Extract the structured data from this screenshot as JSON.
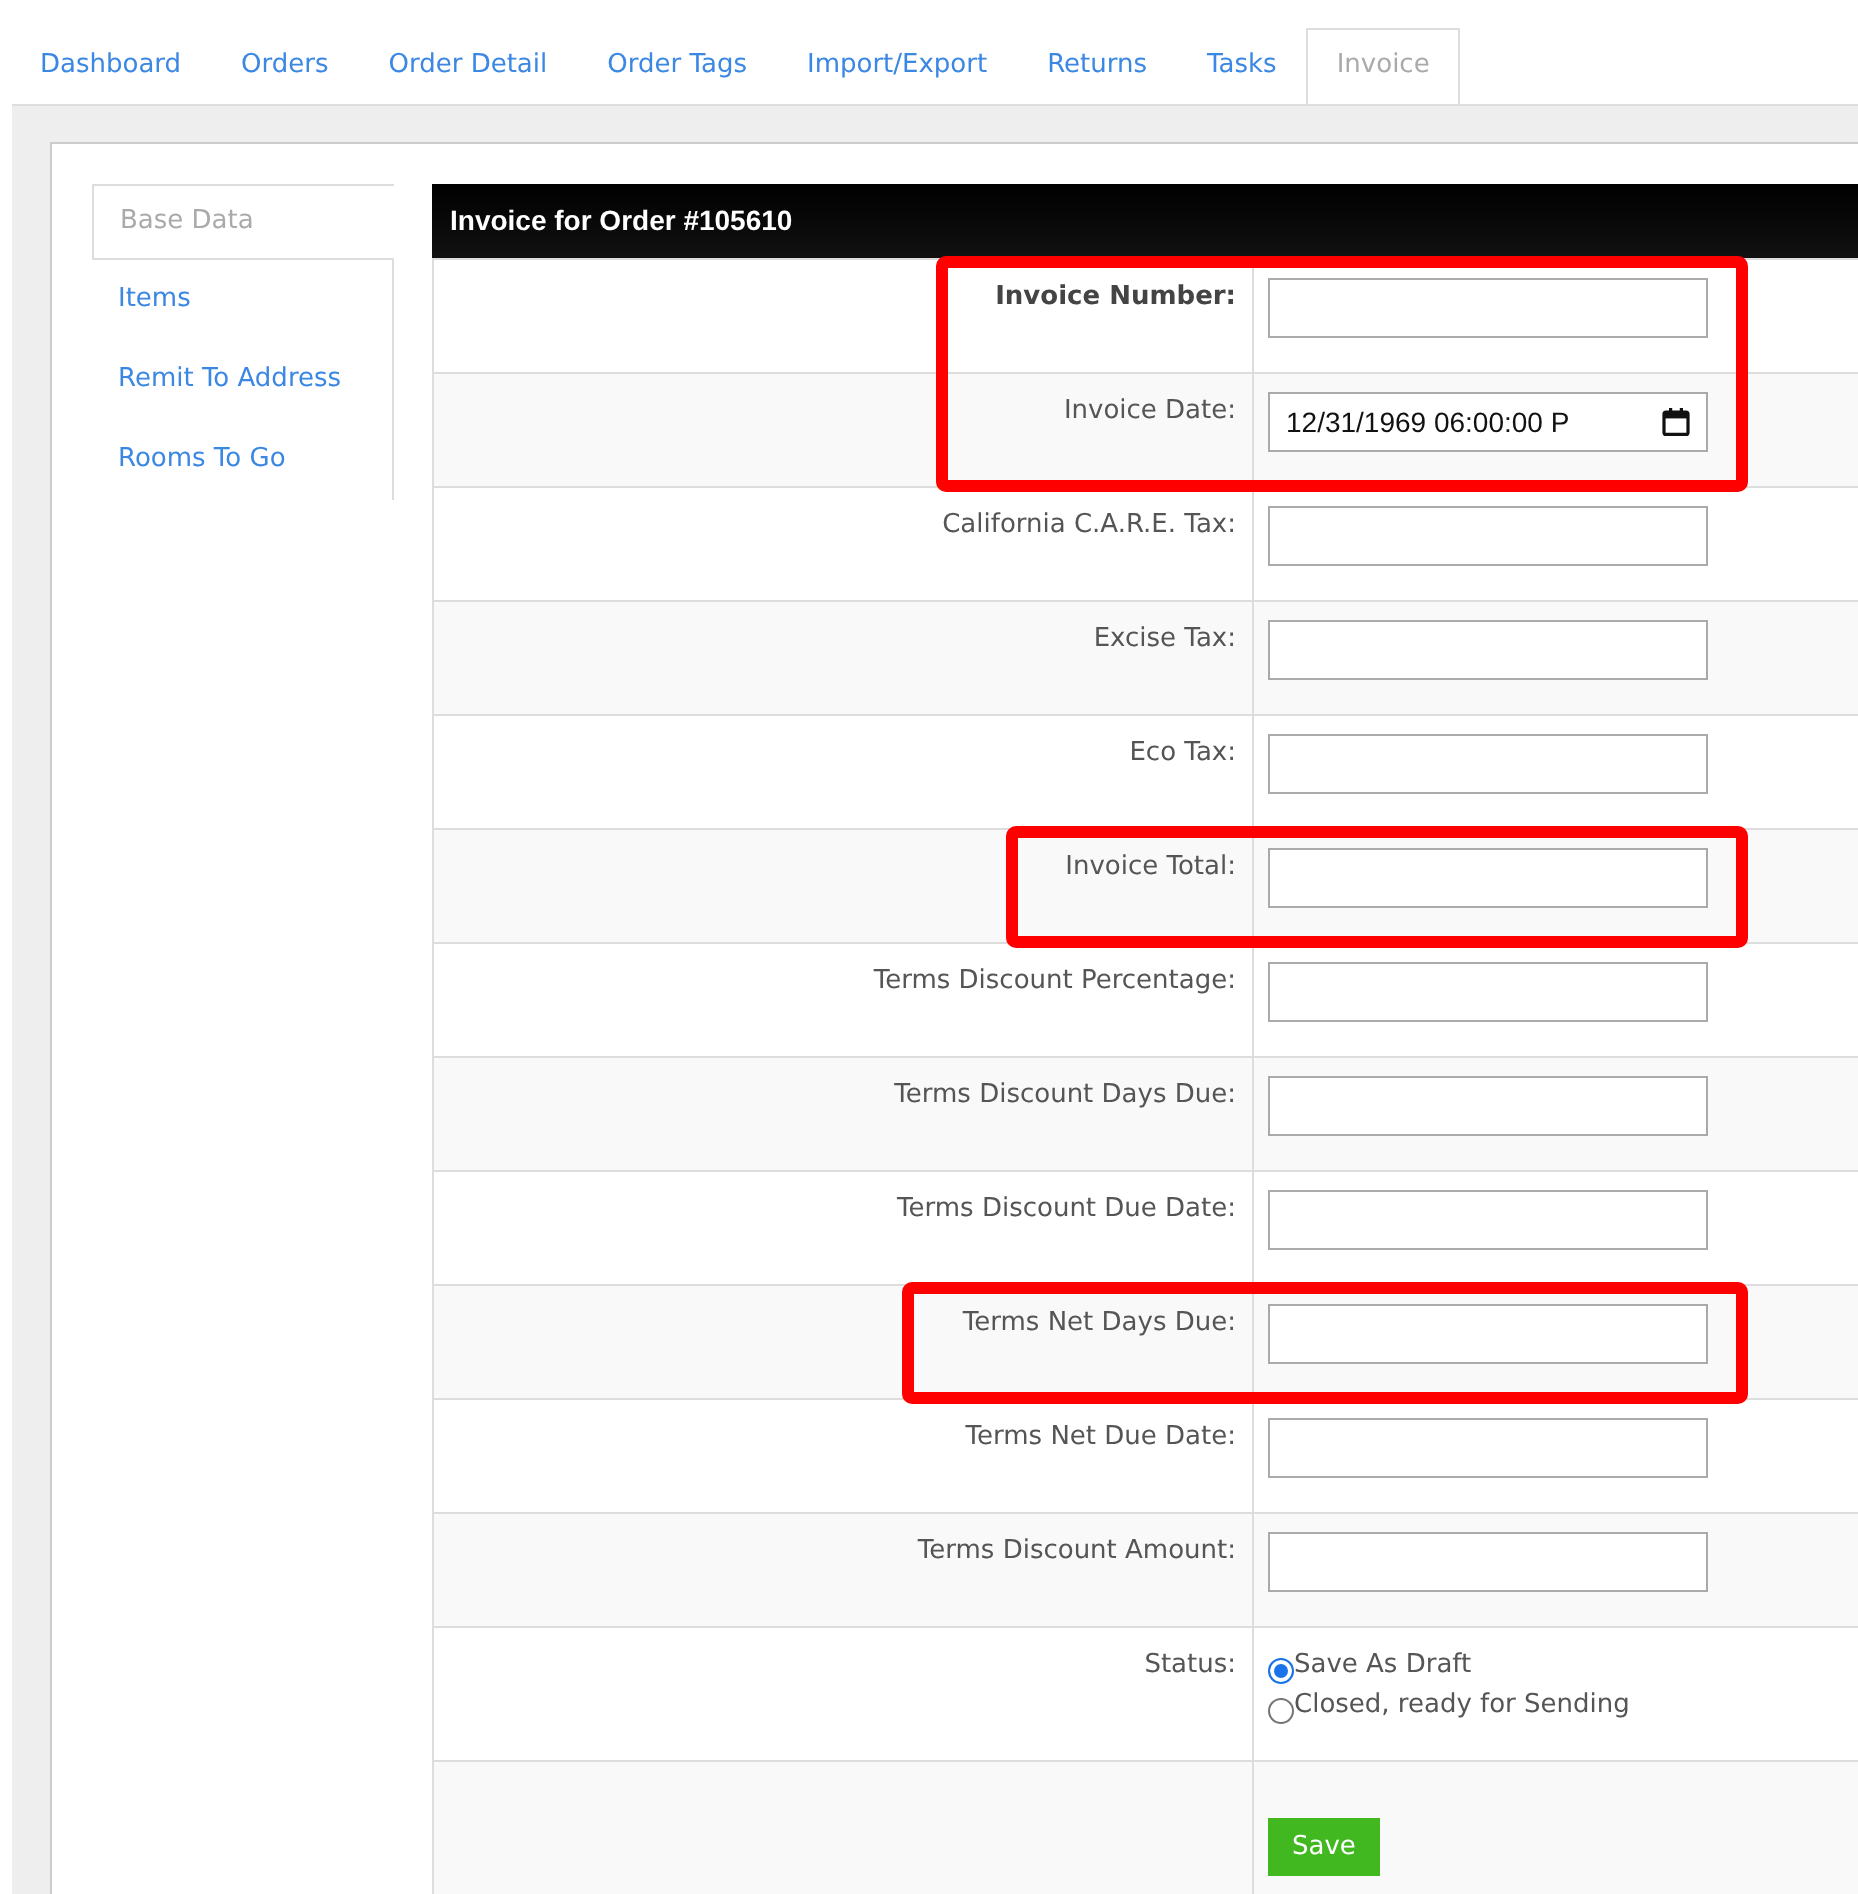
{
  "tabs": [
    {
      "label": "Dashboard",
      "selected": false
    },
    {
      "label": "Orders",
      "selected": false
    },
    {
      "label": "Order Detail",
      "selected": false
    },
    {
      "label": "Order Tags",
      "selected": false
    },
    {
      "label": "Import/Export",
      "selected": false
    },
    {
      "label": "Returns",
      "selected": false
    },
    {
      "label": "Tasks",
      "selected": false
    },
    {
      "label": "Invoice",
      "selected": true
    }
  ],
  "sidebar": {
    "items": [
      {
        "label": "Base Data",
        "selected": true
      },
      {
        "label": "Items",
        "selected": false
      },
      {
        "label": "Remit To Address",
        "selected": false
      },
      {
        "label": "Rooms To Go",
        "selected": false
      }
    ]
  },
  "form": {
    "title": "Invoice for Order #105610",
    "rows": [
      {
        "kind": "text",
        "label": "Invoice Number:",
        "emphasized": true,
        "highlighted": true
      },
      {
        "kind": "date",
        "label": "Invoice Date:",
        "value": "12/31/1969 06:00:00 P",
        "emphasized": false,
        "highlighted": true
      },
      {
        "kind": "text",
        "label": "California C.A.R.E. Tax:",
        "emphasized": false,
        "highlighted": false
      },
      {
        "kind": "text",
        "label": "Excise Tax:",
        "emphasized": false,
        "highlighted": false
      },
      {
        "kind": "text",
        "label": "Eco Tax:",
        "emphasized": false,
        "highlighted": false
      },
      {
        "kind": "text",
        "label": "Invoice Total:",
        "emphasized": false,
        "highlighted": true
      },
      {
        "kind": "text",
        "label": "Terms Discount Percentage:",
        "emphasized": false,
        "highlighted": false
      },
      {
        "kind": "text",
        "label": "Terms Discount Days Due:",
        "emphasized": false,
        "highlighted": false
      },
      {
        "kind": "text",
        "label": "Terms Discount Due Date:",
        "emphasized": false,
        "highlighted": false
      },
      {
        "kind": "text",
        "label": "Terms Net Days Due:",
        "emphasized": false,
        "highlighted": true
      },
      {
        "kind": "text",
        "label": "Terms Net Due Date:",
        "emphasized": false,
        "highlighted": false
      },
      {
        "kind": "text",
        "label": "Terms Discount Amount:",
        "emphasized": false,
        "highlighted": false
      },
      {
        "kind": "radio",
        "label": "Status:",
        "emphasized": false,
        "highlighted": false,
        "options": [
          {
            "label": "Save As Draft",
            "selected": true
          },
          {
            "label": "Closed, ready for Sending",
            "selected": false
          }
        ]
      },
      {
        "kind": "button",
        "button": "Save"
      }
    ]
  }
}
